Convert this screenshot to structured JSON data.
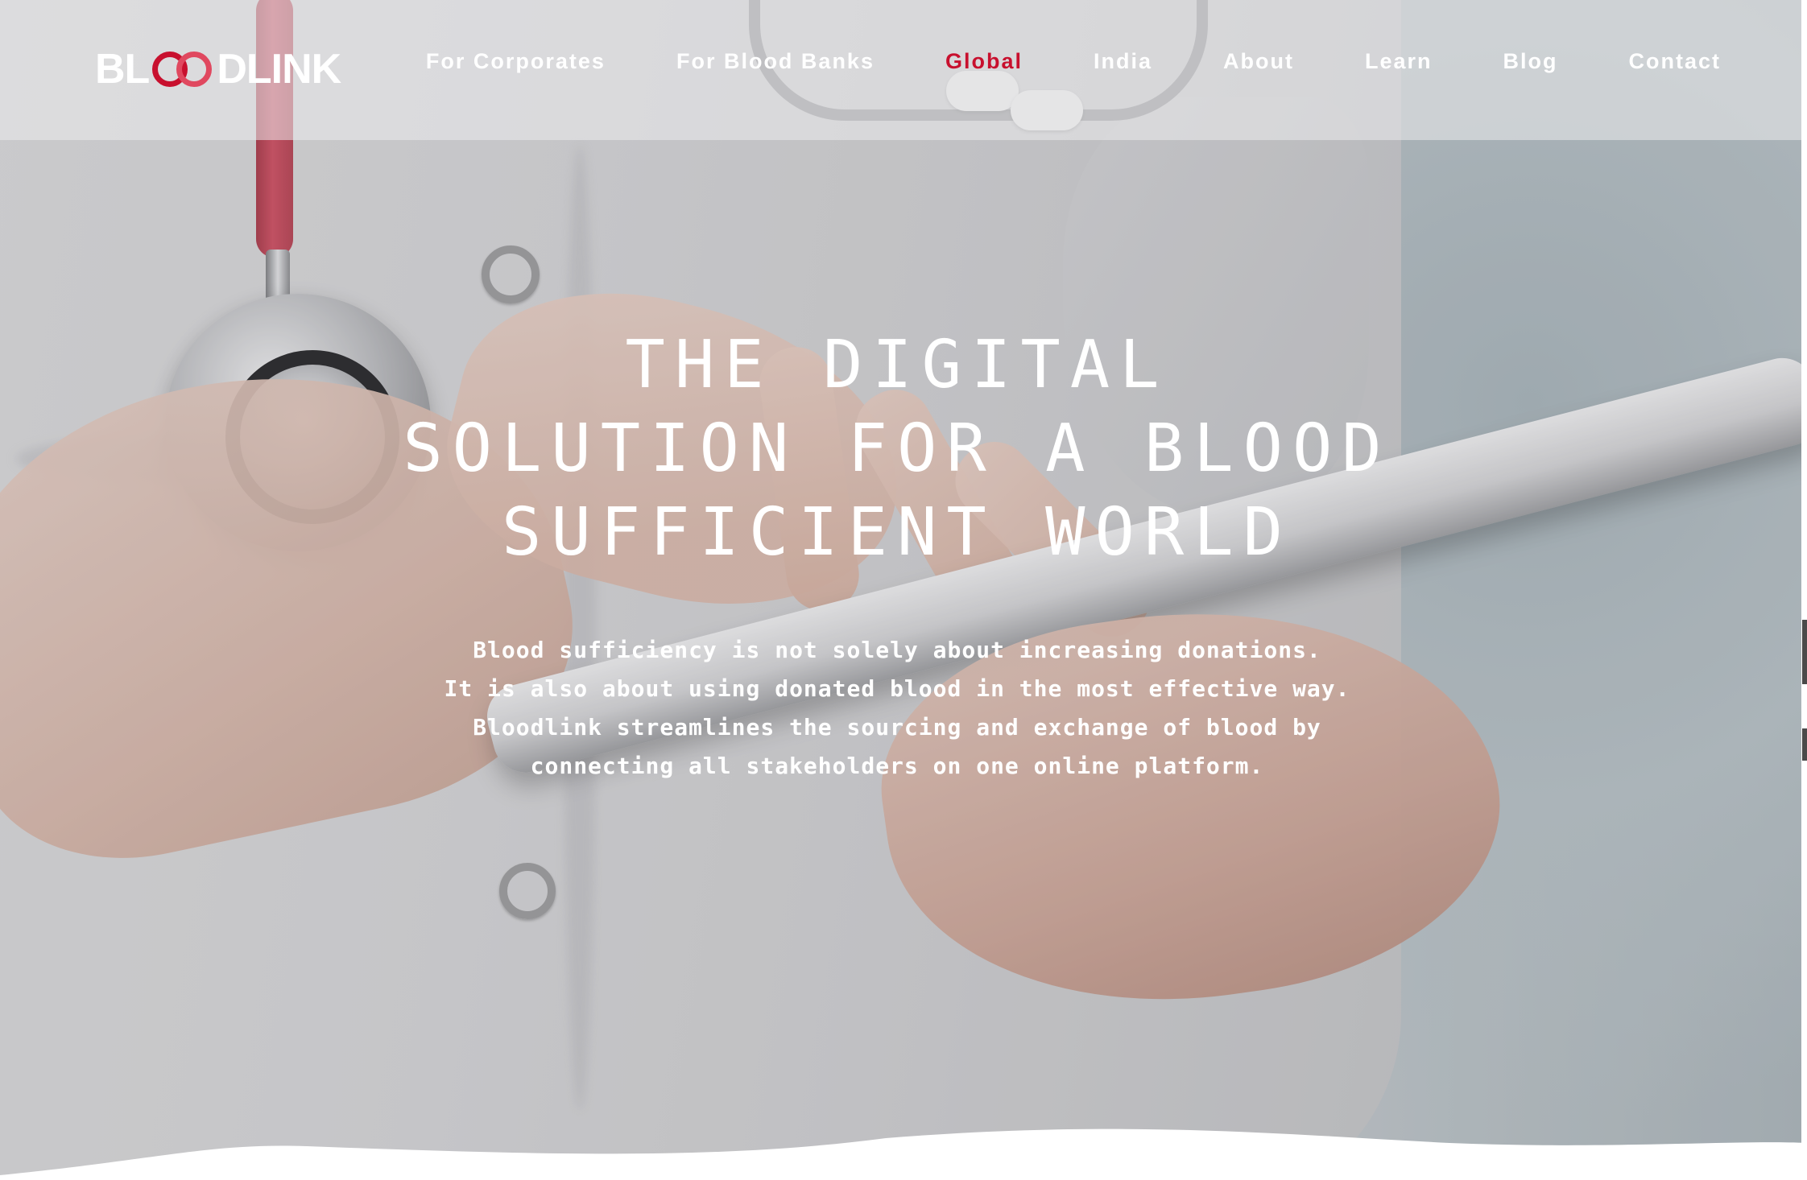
{
  "brand": {
    "logo_text_left": "BL",
    "logo_text_right": "DLINK",
    "logo_alt": "BLOODLINK",
    "accent_color": "#c8102e"
  },
  "nav": {
    "items": [
      {
        "label": "For Corporates",
        "active": false
      },
      {
        "label": "For Blood Banks",
        "active": false
      },
      {
        "label": "Global",
        "active": true
      },
      {
        "label": "India",
        "active": false
      },
      {
        "label": "About",
        "active": false
      },
      {
        "label": "Learn",
        "active": false
      },
      {
        "label": "Blog",
        "active": false
      },
      {
        "label": "Contact",
        "active": false
      }
    ]
  },
  "hero": {
    "headline_lines": [
      "THE DIGITAL",
      "SOLUTION FOR A BLOOD",
      "SUFFICIENT WORLD"
    ],
    "subtext_lines": [
      "Blood sufficiency is not solely about increasing donations.",
      "It is also about using donated blood in the most effective way.",
      "Bloodlink streamlines the sourcing and exchange of blood by",
      "connecting all stakeholders on one online platform."
    ]
  }
}
